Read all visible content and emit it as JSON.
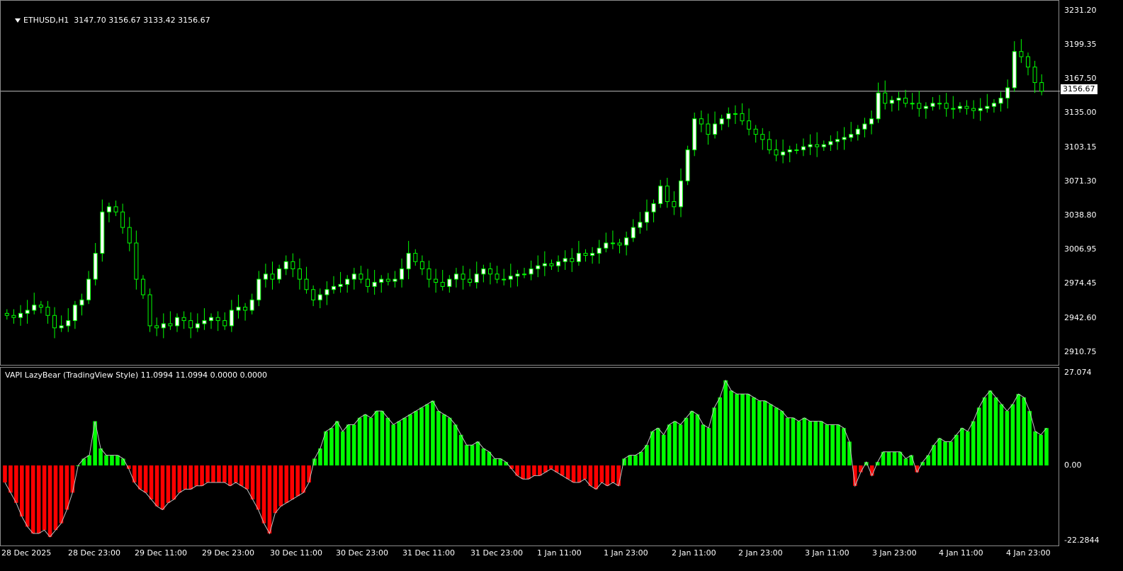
{
  "main": {
    "symbol_header": "ETHUSD,H1  3147.70 3156.67 3133.42 3156.67",
    "menu_icon": "triangle-down-icon",
    "price_axis": [
      "3231.20",
      "3199.35",
      "3167.50",
      "3135.00",
      "3103.15",
      "3071.30",
      "3038.80",
      "3006.95",
      "2974.45",
      "2942.60",
      "2910.75"
    ],
    "current_price": "3156.67",
    "bull_color": "#ffffff",
    "wick_color": "#00ff00",
    "bear_color": "#000000"
  },
  "indicator": {
    "header": "VAPI LazyBear (TradingView Style) 11.0994 11.0994 0.0000 0.0000",
    "axis": [
      "27.074",
      "0.00",
      "-22.2844"
    ],
    "positive_color": "#00ff00",
    "negative_color": "#ff0000",
    "line_color": "#c0c0c0"
  },
  "time_axis": [
    "28 Dec 2025",
    "28 Dec 23:00",
    "29 Dec 11:00",
    "29 Dec 23:00",
    "30 Dec 11:00",
    "30 Dec 23:00",
    "31 Dec 11:00",
    "31 Dec 23:00",
    "1 Jan 11:00",
    "1 Jan 23:00",
    "2 Jan 11:00",
    "2 Jan 23:00",
    "3 Jan 11:00",
    "3 Jan 23:00",
    "4 Jan 11:00",
    "4 Jan 23:00"
  ],
  "chart_data": [
    {
      "type": "candlestick",
      "symbol": "ETHUSD",
      "timeframe": "H1",
      "ylim": [
        2895,
        3240
      ],
      "close": [
        2940,
        2938,
        2942,
        2945,
        2950,
        2948,
        2940,
        2928,
        2930,
        2935,
        2950,
        2955,
        2975,
        3000,
        3040,
        3045,
        3040,
        3025,
        3010,
        2975,
        2960,
        2930,
        2928,
        2932,
        2930,
        2938,
        2935,
        2928,
        2932,
        2935,
        2938,
        2935,
        2930,
        2945,
        2948,
        2945,
        2955,
        2975,
        2980,
        2975,
        2985,
        2992,
        2985,
        2975,
        2965,
        2955,
        2960,
        2965,
        2968,
        2970,
        2975,
        2980,
        2975,
        2968,
        2972,
        2975,
        2973,
        2975,
        2985,
        3000,
        2992,
        2985,
        2975,
        2972,
        2968,
        2975,
        2980,
        2975,
        2972,
        2980,
        2985,
        2980,
        2975,
        2975,
        2978,
        2980,
        2980,
        2985,
        2988,
        2990,
        2988,
        2992,
        2995,
        2992,
        3000,
        2998,
        3000,
        3005,
        3010,
        3010,
        3008,
        3015,
        3025,
        3030,
        3040,
        3048,
        3065,
        3050,
        3045,
        3070,
        3100,
        3130,
        3125,
        3115,
        3125,
        3130,
        3135,
        3135,
        3128,
        3120,
        3115,
        3110,
        3100,
        3095,
        3098,
        3100,
        3100,
        3103,
        3105,
        3103,
        3105,
        3108,
        3110,
        3112,
        3115,
        3120,
        3125,
        3130,
        3155,
        3145,
        3148,
        3150,
        3145,
        3145,
        3140,
        3142,
        3145,
        3145,
        3140,
        3140,
        3142,
        3140,
        3138,
        3140,
        3142,
        3145,
        3150,
        3160,
        3195,
        3190,
        3180,
        3165,
        3156.67
      ],
      "open": [
        2942,
        2940,
        2938,
        2942,
        2945,
        2950,
        2948,
        2940,
        2928,
        2930,
        2935,
        2950,
        2955,
        2975,
        3000,
        3040,
        3045,
        3040,
        3025,
        3010,
        2975,
        2960,
        2930,
        2928,
        2932,
        2930,
        2938,
        2935,
        2928,
        2932,
        2935,
        2938,
        2935,
        2930,
        2945,
        2948,
        2945,
        2955,
        2975,
        2980,
        2975,
        2985,
        2992,
        2985,
        2975,
        2965,
        2955,
        2960,
        2965,
        2968,
        2970,
        2975,
        2980,
        2975,
        2968,
        2972,
        2975,
        2973,
        2975,
        2985,
        3000,
        2992,
        2985,
        2975,
        2972,
        2968,
        2975,
        2980,
        2975,
        2972,
        2980,
        2985,
        2980,
        2975,
        2975,
        2978,
        2980,
        2980,
        2985,
        2988,
        2990,
        2988,
        2992,
        2995,
        2992,
        3000,
        2998,
        3000,
        3005,
        3010,
        3010,
        3008,
        3015,
        3025,
        3030,
        3040,
        3048,
        3065,
        3050,
        3045,
        3070,
        3100,
        3130,
        3125,
        3115,
        3125,
        3130,
        3135,
        3135,
        3128,
        3120,
        3115,
        3110,
        3100,
        3095,
        3098,
        3100,
        3100,
        3103,
        3105,
        3103,
        3105,
        3108,
        3110,
        3112,
        3115,
        3120,
        3125,
        3130,
        3155,
        3145,
        3148,
        3150,
        3145,
        3145,
        3140,
        3142,
        3145,
        3145,
        3140,
        3140,
        3142,
        3140,
        3138,
        3140,
        3142,
        3145,
        3150,
        3160,
        3195,
        3190,
        3180,
        3165
      ]
    },
    {
      "type": "bar",
      "name": "VAPI LazyBear (TradingView Style)",
      "ylim": [
        -22.2844,
        27.074
      ],
      "values": [
        -5,
        -8,
        -11,
        -15,
        -18,
        -20,
        -20,
        -19,
        -21,
        -19,
        -17,
        -13,
        -8,
        0,
        2,
        3,
        13,
        5,
        3,
        3,
        3,
        2,
        -1,
        -5,
        -7,
        -8,
        -10,
        -12,
        -13,
        -11,
        -10,
        -8,
        -7,
        -7,
        -6,
        -6,
        -5,
        -5,
        -5,
        -5,
        -6,
        -5,
        -6,
        -7,
        -10,
        -13,
        -17,
        -20,
        -14,
        -12,
        -11,
        -10,
        -9,
        -8,
        -5,
        2,
        5,
        10,
        11,
        13,
        10,
        12,
        12,
        14,
        15,
        14,
        16,
        16,
        14,
        12,
        13,
        14,
        15,
        16,
        17,
        18,
        19,
        16,
        15,
        14,
        12,
        9,
        6,
        6,
        7,
        5,
        4,
        2,
        2,
        1,
        -1,
        -3,
        -4,
        -4,
        -3,
        -3,
        -2,
        -1,
        -2,
        -3,
        -4,
        -5,
        -5,
        -4,
        -6,
        -7,
        -5,
        -6,
        -5,
        -6,
        2,
        3,
        3,
        4,
        6,
        10,
        11,
        9,
        12,
        13,
        12,
        14,
        16,
        15,
        12,
        11,
        17,
        20,
        25,
        22,
        21,
        21,
        21,
        20,
        19,
        19,
        18,
        17,
        16,
        14,
        14,
        13,
        14,
        13,
        13,
        13,
        12,
        12,
        12,
        11,
        7,
        -6,
        -2,
        1,
        -3,
        1,
        4,
        4,
        4,
        4,
        2,
        3,
        -2,
        1,
        3,
        6,
        8,
        7,
        7,
        9,
        11,
        10,
        13,
        17,
        20,
        22,
        20,
        18,
        16,
        18,
        21,
        20,
        16,
        10,
        9,
        11
      ]
    }
  ]
}
